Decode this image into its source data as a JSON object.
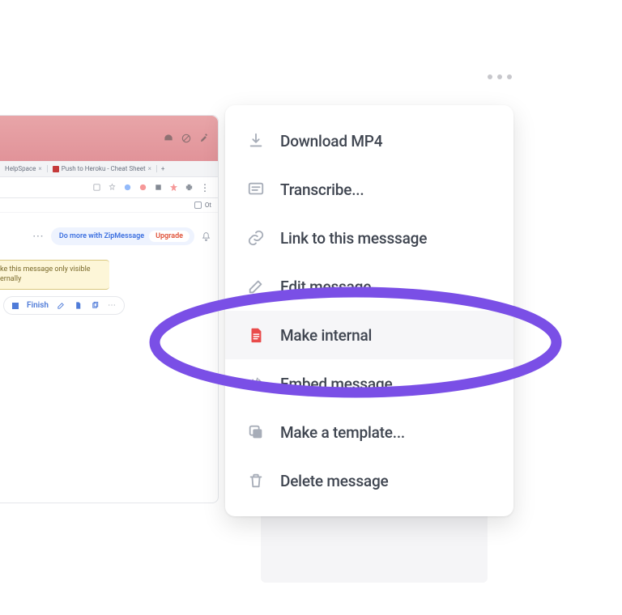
{
  "kebab": {
    "name": "more-actions"
  },
  "background": {
    "tab2": "Push to Heroku - Cheat Sheet",
    "tab1_suffix": "HelpSpace",
    "other_label": "Ot",
    "zip": {
      "do_more": "Do more with ZipMessage",
      "upgrade": "Upgrade"
    },
    "yellow_line1": "ke this message only visible",
    "yellow_line2": "ernally",
    "finish_label": "Finish"
  },
  "menu": {
    "items": [
      {
        "id": "download-mp4",
        "label": "Download MP4",
        "icon": "download",
        "hover": false
      },
      {
        "id": "transcribe",
        "label": "Transcribe...",
        "icon": "transcript",
        "hover": false
      },
      {
        "id": "link-message",
        "label": "Link to this messsage",
        "icon": "link",
        "hover": false
      },
      {
        "id": "edit-message",
        "label": "Edit message",
        "icon": "edit",
        "hover": false
      },
      {
        "id": "make-internal",
        "label": "Make internal",
        "icon": "document-red",
        "hover": true
      },
      {
        "id": "embed-message",
        "label": "Embed message...",
        "icon": "code",
        "hover": false
      },
      {
        "id": "make-template",
        "label": "Make a template...",
        "icon": "copy",
        "hover": false
      },
      {
        "id": "delete-message",
        "label": "Delete message",
        "icon": "trash",
        "hover": false
      }
    ]
  },
  "annotation": {
    "color": "#7a4fe6"
  }
}
